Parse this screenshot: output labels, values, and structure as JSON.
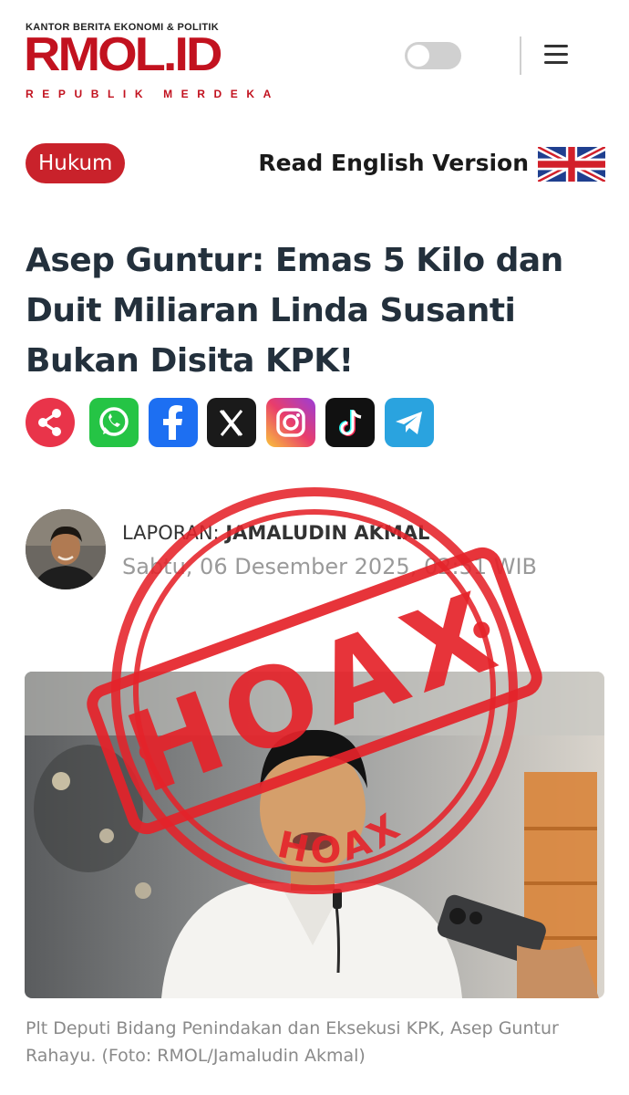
{
  "header": {
    "logo_tagline": "KANTOR BERITA EKONOMI & POLITIK",
    "logo_text": "RMOL.ID",
    "logo_subtitle": "REPUBLIK MERDEKA"
  },
  "article": {
    "category": "Hukum",
    "read_english": "Read English Version",
    "headline": "Asep Guntur: Emas 5 Kilo dan Duit Miliaran Linda Susanti Bukan Disita KPK!",
    "reporter_label": "LAPORAN:",
    "reporter_name": "JAMALUDIN AKMAL",
    "date": "Sabtu, 06 Desember 2025, 02:51 WIB",
    "caption": "Plt Deputi Bidang Penindakan dan Eksekusi KPK, Asep Guntur Rahayu. (Foto: RMOL/Jamaludin Akmal)"
  },
  "share_icons": [
    "share-icon",
    "whatsapp-icon",
    "facebook-icon",
    "x-icon",
    "instagram-icon",
    "tiktok-icon",
    "telegram-icon"
  ],
  "stamp": {
    "center_word": "HOAX",
    "ring_top": "HOAX",
    "ring_bottom": "HOAX"
  },
  "colors": {
    "brand_red": "#c2121f",
    "category_bg": "#c9222b",
    "stamp_red": "#e5232a",
    "headline": "#23303c"
  }
}
